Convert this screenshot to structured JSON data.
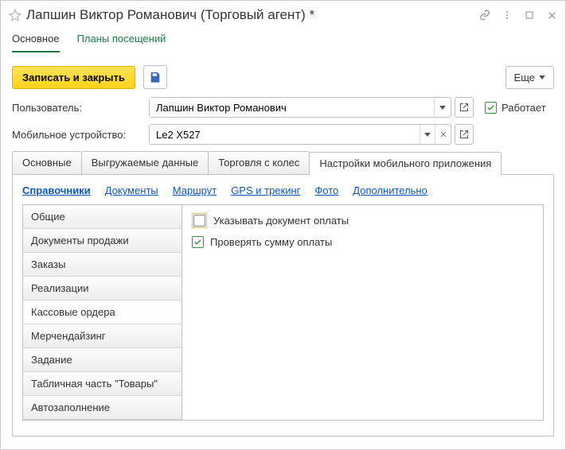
{
  "title": "Лапшин Виктор Романович (Торговый агент) *",
  "top_links": {
    "main": "Основное",
    "plans": "Планы посещений"
  },
  "actions": {
    "save_close": "Записать и закрыть",
    "more": "Еще"
  },
  "fields": {
    "user_label": "Пользователь:",
    "user_value": "Лапшин Виктор Романович",
    "device_label": "Мобильное устройство:",
    "device_value": "Le2 X527",
    "works_label": "Работает"
  },
  "tabs": {
    "t1": "Основные",
    "t2": "Выгружаемые данные",
    "t3": "Торговля с колес",
    "t4": "Настройки мобильного приложения"
  },
  "bluelinks": {
    "l1": "Справочники",
    "l2": "Документы",
    "l3": "Маршрут",
    "l4": "GPS и трекинг",
    "l5": "Фото",
    "l6": "Дополнительно"
  },
  "leftlist": {
    "i1": "Общие",
    "i2": "Документы продажи",
    "i3": "Заказы",
    "i4": "Реализации",
    "i5": "Кассовые ордера",
    "i6": "Мерчендайзинг",
    "i7": "Задание",
    "i8": "Табличная часть \"Товары\"",
    "i9": "Автозаполнение"
  },
  "options": {
    "o1": "Указывать документ оплаты",
    "o2": "Проверять сумму оплаты"
  }
}
